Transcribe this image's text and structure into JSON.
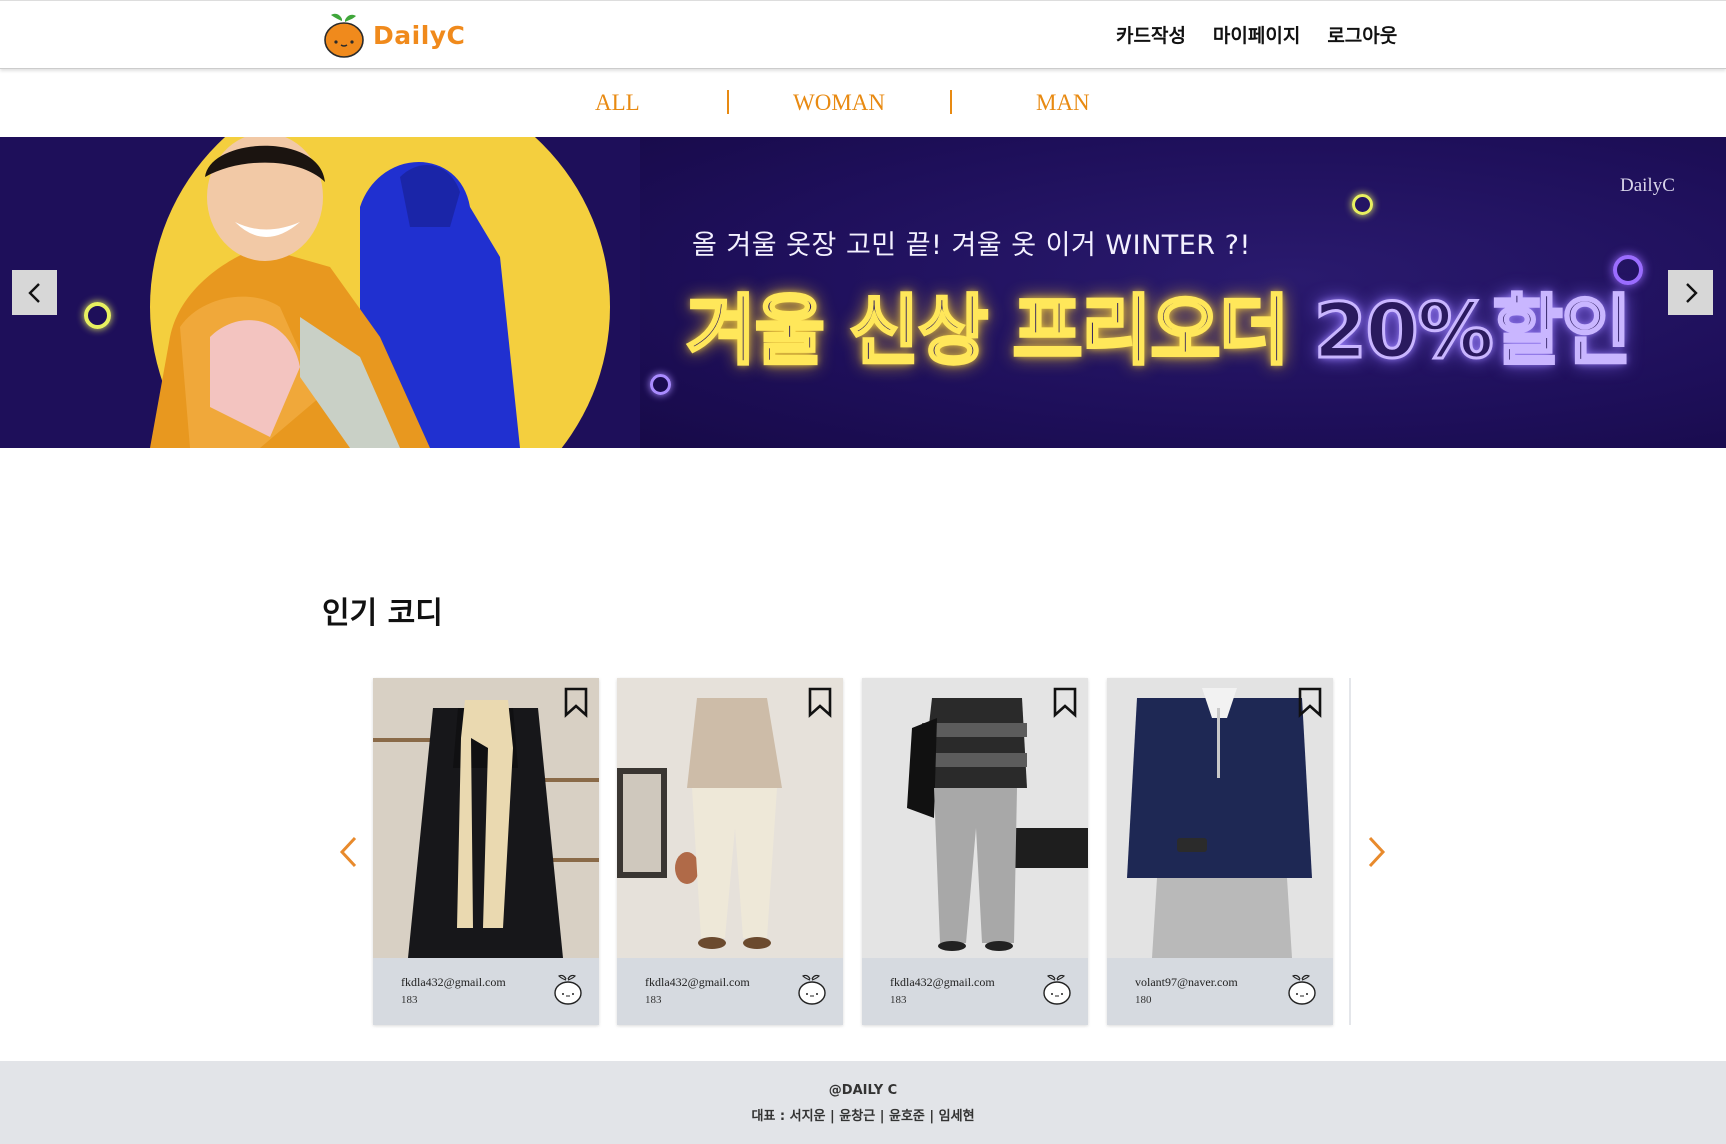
{
  "header": {
    "logo_text": "DailyC",
    "nav": [
      "카드작성",
      "마이페이지",
      "로그아웃"
    ]
  },
  "categories": [
    "ALL",
    "WOMAN",
    "MAN"
  ],
  "banner": {
    "small_text": "올 겨울 옷장 고민 끝! 겨울 옷 이거 WINTER ?!",
    "big_text_yellow": "겨울 신상 프리오더",
    "big_text_purple": "20%할인",
    "brand": "DailyC"
  },
  "section": {
    "title": "인기 코디"
  },
  "cards": [
    {
      "email": "fkdla432@gmail.com",
      "height": "183",
      "image": "black-coat-beige-scarf"
    },
    {
      "email": "fkdla432@gmail.com",
      "height": "183",
      "image": "beige-turtleneck-cream-pants"
    },
    {
      "email": "fkdla432@gmail.com",
      "height": "183",
      "image": "striped-sweater-grey-jeans"
    },
    {
      "email": "volant97@naver.com",
      "height": "180",
      "image": "navy-halfzip-grey-pants"
    }
  ],
  "footer": {
    "brand": "@DAILY C",
    "members": "대표 : 서지운 | 윤창근 | 윤호준 | 임세현"
  },
  "colors": {
    "accent": "#f08a1c",
    "banner_bg": "#1e0f5a",
    "card_bg": "#d6dae0",
    "footer_bg": "#e2e4e8"
  }
}
